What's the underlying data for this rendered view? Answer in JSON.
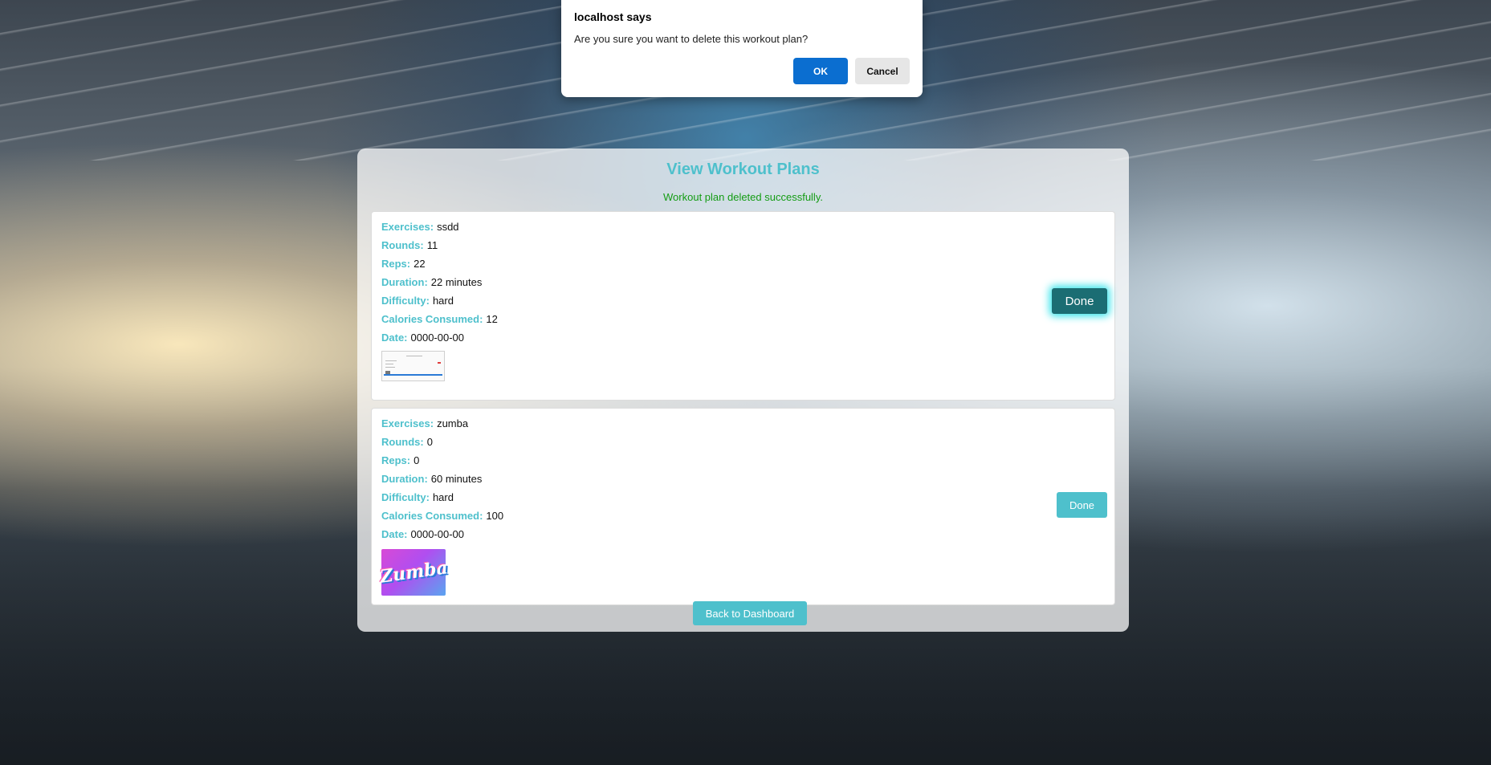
{
  "dialog": {
    "title": "localhost says",
    "message": "Are you sure you want to delete this workout plan?",
    "ok_label": "OK",
    "cancel_label": "Cancel"
  },
  "page": {
    "title": "View Workout Plans",
    "flash_message": "Workout plan deleted successfully.",
    "back_label": "Back to Dashboard"
  },
  "labels": {
    "exercises": "Exercises:",
    "rounds": "Rounds:",
    "reps": "Reps:",
    "duration": "Duration:",
    "difficulty": "Difficulty:",
    "calories": "Calories Consumed:",
    "date": "Date:"
  },
  "plans": [
    {
      "exercises": "ssdd",
      "rounds": "11",
      "reps": "22",
      "duration": "22 minutes",
      "difficulty": "hard",
      "calories": "12",
      "date": "0000-00-00",
      "done_label": "Done"
    },
    {
      "exercises": "zumba",
      "rounds": "0",
      "reps": "0",
      "duration": "60 minutes",
      "difficulty": "hard",
      "calories": "100",
      "date": "0000-00-00",
      "done_label": "Done",
      "image_text": "Zumba"
    }
  ],
  "colors": {
    "accent": "#4ec0cc",
    "success": "#149c14",
    "dialog_ok": "#0b6ed0",
    "done_active": "#1b6d73"
  }
}
